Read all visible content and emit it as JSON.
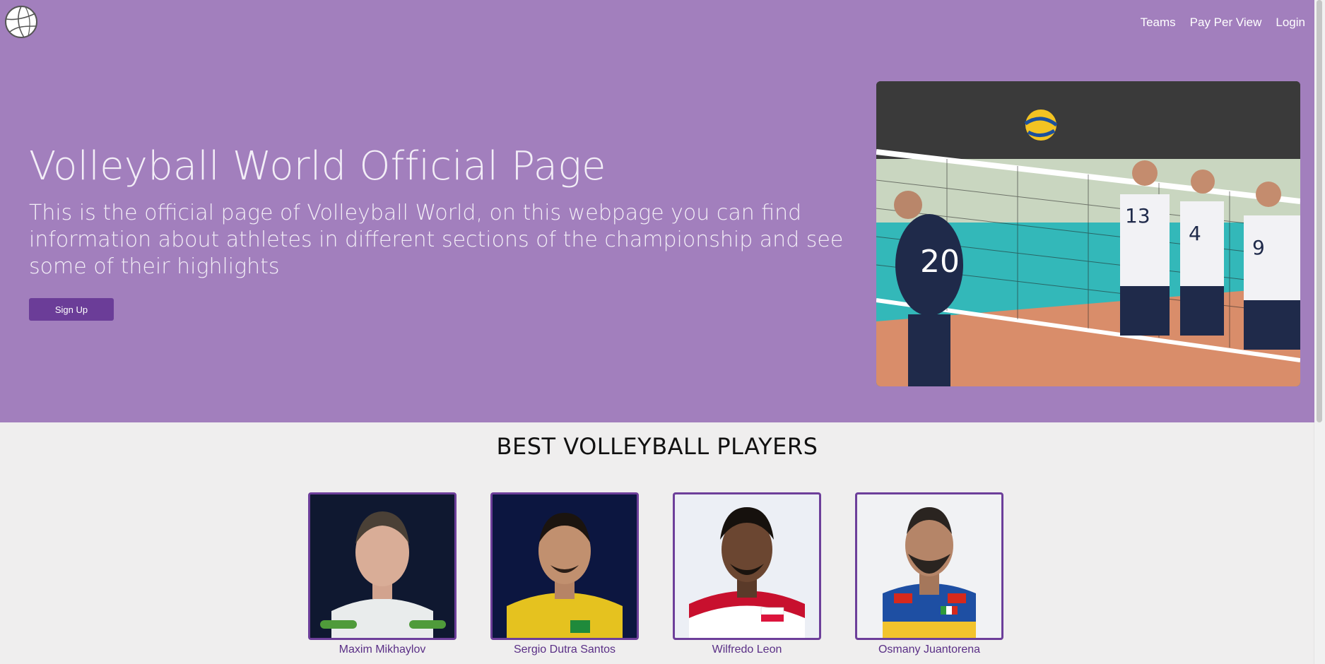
{
  "nav": {
    "items": [
      {
        "label": "Teams"
      },
      {
        "label": "Pay Per View"
      },
      {
        "label": "Login"
      }
    ]
  },
  "hero": {
    "title": "Volleyball World Official Page",
    "description": "This is the official page of Volleyball World, on this webpage you can find information about athletes in different sections of the championship and see some of their highlights",
    "signup_label": "Sign Up"
  },
  "players_section": {
    "title": "BEST VOLLEYBALL PLAYERS",
    "players": [
      {
        "name": "Maxim Mikhaylov"
      },
      {
        "name": "Sergio Dutra Santos"
      },
      {
        "name": "Wilfredo Leon"
      },
      {
        "name": "Osmany Juantorena"
      }
    ]
  },
  "colors": {
    "hero_bg": "#a27fbd",
    "accent": "#6b3d98",
    "page_bg": "#efeeee"
  }
}
